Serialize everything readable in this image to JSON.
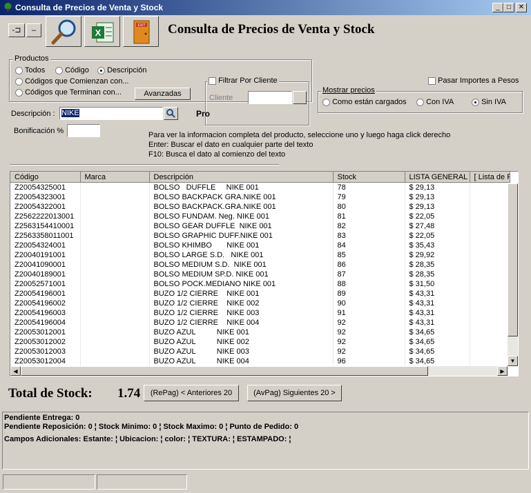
{
  "window": {
    "title": "Consulta de Precios de Venta y Stock"
  },
  "toolbar": {
    "pin_label": "-⊐",
    "minus_label": "–",
    "exit_label": "EXIT"
  },
  "header": {
    "title": "Consulta de Precios de Venta y Stock"
  },
  "productos": {
    "legend": "Productos",
    "options": [
      "Todos",
      "Código",
      "Descripción",
      "Códigos que Comienzan con...",
      "Códigos que Terminan con..."
    ],
    "selected": "Descripción",
    "avanzadas_label": "Avanzadas"
  },
  "filtro": {
    "label": "Filtrar Por Cliente",
    "cliente_label": "Cliente",
    "cliente_value": ""
  },
  "pasar_importes": {
    "label": "Pasar Importes a Pesos"
  },
  "mostrar_precios": {
    "legend": "Mostrar precios",
    "options": [
      "Como están cargados",
      "Con IVA",
      "Sin IVA"
    ],
    "selected": "Sin IVA"
  },
  "descripcion": {
    "label": "Descripción :",
    "value": "NIKE",
    "extra": "Pro"
  },
  "bonificacion": {
    "label": "Bonificación %",
    "value": ""
  },
  "help": {
    "line1": "Para ver la informacion completa del producto, seleccione uno y luego haga click derecho",
    "line2": "Enter: Buscar el dato en cualquier parte del texto",
    "line3": "F10: Busca el dato al comienzo del texto"
  },
  "grid": {
    "columns": [
      "Código",
      "Marca",
      "Descripción",
      "Stock",
      "LISTA GENERAL",
      "[ Lista de F"
    ],
    "rows": [
      [
        "Z20054325001",
        "",
        "BOLSO   DUFFLE     NIKE 001",
        "78",
        "$ 29,13"
      ],
      [
        "Z20054323001",
        "",
        "BOLSO BACKPACK GRA.NIKE 001",
        "79",
        "$ 29,13"
      ],
      [
        "Z20054322001",
        "",
        "BOLSO BACKPACK.GRA.NIKE 001",
        "80",
        "$ 29,13"
      ],
      [
        "Z2562222013001",
        "",
        "BOLSO FUNDAM. Neg. NIKE 001",
        "81",
        "$ 22,05"
      ],
      [
        "Z2563154410001",
        "",
        "BOLSO GEAR DUFFLE  NIKE 001",
        "82",
        "$ 27,48"
      ],
      [
        "Z2563358011001",
        "",
        "BOLSO GRAPHIC DUFF.NIKE 001",
        "83",
        "$ 22,05"
      ],
      [
        "Z20054324001",
        "",
        "BOLSO KHIMBO       NIKE 001",
        "84",
        "$ 35,43"
      ],
      [
        "Z20040191001",
        "",
        "BOLSO LARGE S.D.   NIKE 001",
        "85",
        "$ 29,92"
      ],
      [
        "Z20041090001",
        "",
        "BOLSO MEDIUM S.D.  NIKE 001",
        "86",
        "$ 28,35"
      ],
      [
        "Z20040189001",
        "",
        "BOLSO MEDIUM SP.D. NIKE 001",
        "87",
        "$ 28,35"
      ],
      [
        "Z20052571001",
        "",
        "BOLSO POCK.MEDIANO NIKE 001",
        "88",
        "$ 31,50"
      ],
      [
        "Z20054196001",
        "",
        "BUZO 1/2 CIERRE    NIKE 001",
        "89",
        "$ 43,31"
      ],
      [
        "Z20054196002",
        "",
        "BUZO 1/2 CIERRE    NIKE 002",
        "90",
        "$ 43,31"
      ],
      [
        "Z20054196003",
        "",
        "BUZO 1/2 CIERRE    NIKE 003",
        "91",
        "$ 43,31"
      ],
      [
        "Z20054196004",
        "",
        "BUZO 1/2 CIERRE    NIKE 004",
        "92",
        "$ 43,31"
      ],
      [
        "Z20053012001",
        "",
        "BUZO AZUL          NIKE 001",
        "92",
        "$ 34,65"
      ],
      [
        "Z20053012002",
        "",
        "BUZO AZUL          NIKE 002",
        "92",
        "$ 34,65"
      ],
      [
        "Z20053012003",
        "",
        "BUZO AZUL          NIKE 003",
        "92",
        "$ 34,65"
      ],
      [
        "Z20053012004",
        "",
        "BUZO AZUL          NIKE 004",
        "96",
        "$ 34,65"
      ]
    ]
  },
  "footer": {
    "total_label": "Total de Stock:",
    "total_value": "1.74",
    "prev_label": "(RePag) < Anteriores 20",
    "next_label": "(AvPag) Siguientes 20 >"
  },
  "info": {
    "line1": "Pendiente Entrega: 0",
    "line2": "Pendiente Reposición: 0 ¦ Stock Minimo: 0 ¦ Stock Maximo: 0 ¦ Punto de Pedido: 0",
    "line3": "Campos Adicionales: Estante: ¦ Ubicacion: ¦ color: ¦ TEXTURA: ¦ ESTAMPADO: ¦"
  }
}
